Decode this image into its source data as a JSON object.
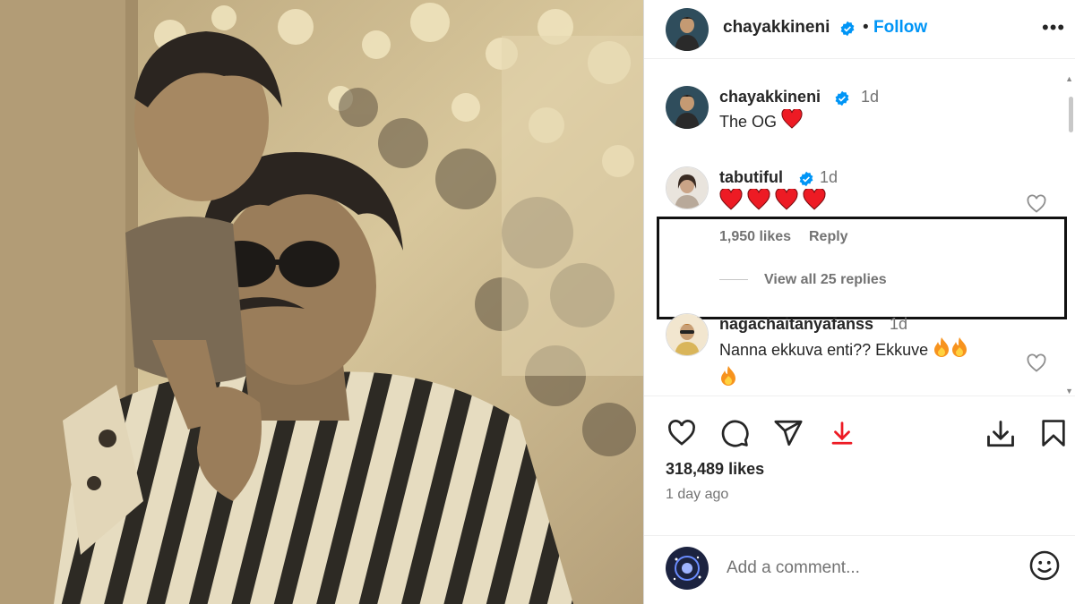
{
  "post": {
    "author": "chayakkineni",
    "follow_label": "Follow",
    "separator": "•",
    "more_label": "•••",
    "likes_text": "318,489 likes",
    "time_ago": "1 day ago"
  },
  "comments": [
    {
      "username": "chayakkineni",
      "time": "1d",
      "text": "The OG",
      "emoji": [
        "red-heart"
      ]
    },
    {
      "username": "tabutiful",
      "time": "1d",
      "emoji": [
        "red-heart",
        "red-heart",
        "red-heart",
        "red-heart"
      ],
      "likes": "1,950 likes",
      "reply_label": "Reply",
      "view_replies": "View all 25 replies"
    },
    {
      "username": "nagachaitanyafanss",
      "time": "1d",
      "text": "Nanna ekkuva enti?? Ekkuve",
      "emoji": [
        "fire",
        "fire",
        "fire"
      ]
    }
  ],
  "composer": {
    "placeholder": "Add a comment..."
  },
  "colors": {
    "accent": "#0095f6",
    "heart": "#ed1b24",
    "muted": "#737373",
    "highlight_border": "#111111"
  },
  "icons": [
    "like-icon",
    "comment-icon",
    "share-icon",
    "download-arrow-icon",
    "download-icon",
    "bookmark-icon",
    "emoji-icon",
    "verified-icon",
    "heart-icon"
  ]
}
